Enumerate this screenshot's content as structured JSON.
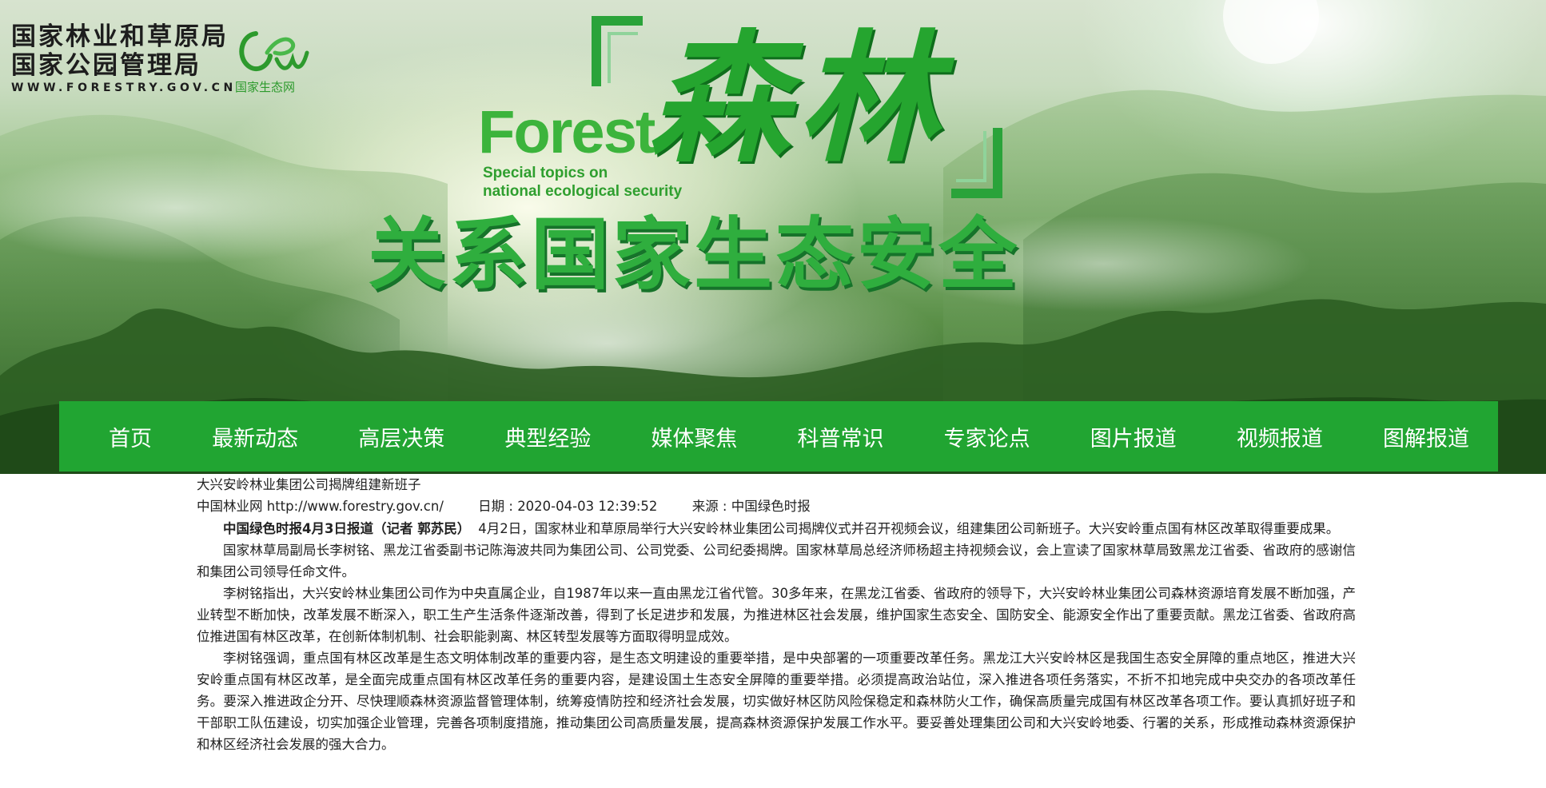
{
  "header": {
    "org_line1": "国家林业和草原局",
    "org_line2": "国家公园管理局",
    "org_url": "WWW.FORESTRY.GOV.CN",
    "logo_caption": "国家生态网",
    "forest_word": "Forest",
    "forest_sub1": "Special topics on",
    "forest_sub2": "national ecological security",
    "title_calligraphy": "森林",
    "slogan": "关系国家生态安全"
  },
  "nav": {
    "items": [
      {
        "label": "首页"
      },
      {
        "label": "最新动态"
      },
      {
        "label": "高层决策"
      },
      {
        "label": "典型经验"
      },
      {
        "label": "媒体聚焦"
      },
      {
        "label": "科普常识"
      },
      {
        "label": "专家论点"
      },
      {
        "label": "图片报道"
      },
      {
        "label": "视频报道"
      },
      {
        "label": "图解报道"
      }
    ]
  },
  "article": {
    "title": "大兴安岭林业集团公司揭牌组建新班子",
    "source_site": "中国林业网 http://www.forestry.gov.cn/",
    "date": "日期 : 2020-04-03 12:39:52",
    "source": "来源 : 中国绿色时报",
    "lead": "中国绿色时报4月3日报道（记者 郭苏民）",
    "paragraphs": [
      "4月2日，国家林业和草原局举行大兴安岭林业集团公司揭牌仪式并召开视频会议，组建集团公司新班子。大兴安岭重点国有林区改革取得重要成果。",
      "国家林草局副局长李树铭、黑龙江省委副书记陈海波共同为集团公司、公司党委、公司纪委揭牌。国家林草局总经济师杨超主持视频会议，会上宣读了国家林草局致黑龙江省委、省政府的感谢信和集团公司领导任命文件。",
      "李树铭指出，大兴安岭林业集团公司作为中央直属企业，自1987年以来一直由黑龙江省代管。30多年来，在黑龙江省委、省政府的领导下，大兴安岭林业集团公司森林资源培育发展不断加强，产业转型不断加快，改革发展不断深入，职工生产生活条件逐渐改善，得到了长足进步和发展，为推进林区社会发展，维护国家生态安全、国防安全、能源安全作出了重要贡献。黑龙江省委、省政府高位推进国有林区改革，在创新体制机制、社会职能剥离、林区转型发展等方面取得明显成效。",
      "李树铭强调，重点国有林区改革是生态文明体制改革的重要内容，是生态文明建设的重要举措，是中央部署的一项重要改革任务。黑龙江大兴安岭林区是我国生态安全屏障的重点地区，推进大兴安岭重点国有林区改革，是全面完成重点国有林区改革任务的重要内容，是建设国土生态安全屏障的重要举措。必须提高政治站位，深入推进各项任务落实，不折不扣地完成中央交办的各项改革任务。要深入推进政企分开、尽快理顺森林资源监督管理体制，统筹疫情防控和经济社会发展，切实做好林区防风险保稳定和森林防火工作，确保高质量完成国有林区改革各项工作。要认真抓好班子和干部职工队伍建设，切实加强企业管理，完善各项制度措施，推动集团公司高质量发展，提高森林资源保护发展工作水平。要妥善处理集团公司和大兴安岭地委、行署的关系，形成推动森林资源保护和林区经济社会发展的强大合力。"
    ]
  }
}
